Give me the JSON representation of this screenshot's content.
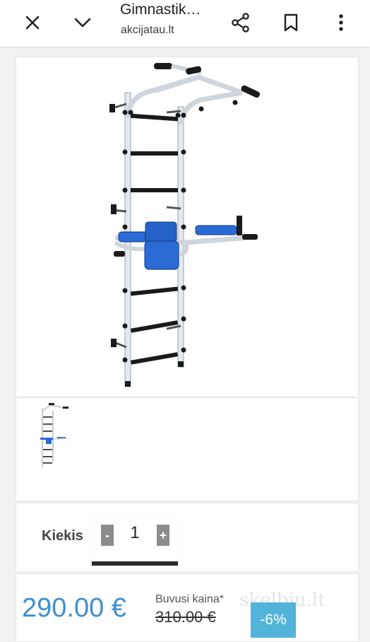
{
  "browser": {
    "title": "Gimnastik…",
    "url": "akcijatau.lt",
    "icons": [
      "close-icon",
      "chevron-down-icon",
      "share-icon",
      "bookmark-icon",
      "more-vert-icon"
    ]
  },
  "quantity": {
    "label": "Kiekis",
    "minus": "-",
    "value": "1",
    "plus": "+"
  },
  "pricing": {
    "price": "290.00 €",
    "old_label": "Buvusi kaina*",
    "old_price": "310.00 €",
    "discount": "-6%",
    "watermark": "skelbiu.lt"
  },
  "colors": {
    "price": "#3d8fcf",
    "discount_bg": "#52b4d9",
    "stepper_btn": "#8c8c8c"
  }
}
